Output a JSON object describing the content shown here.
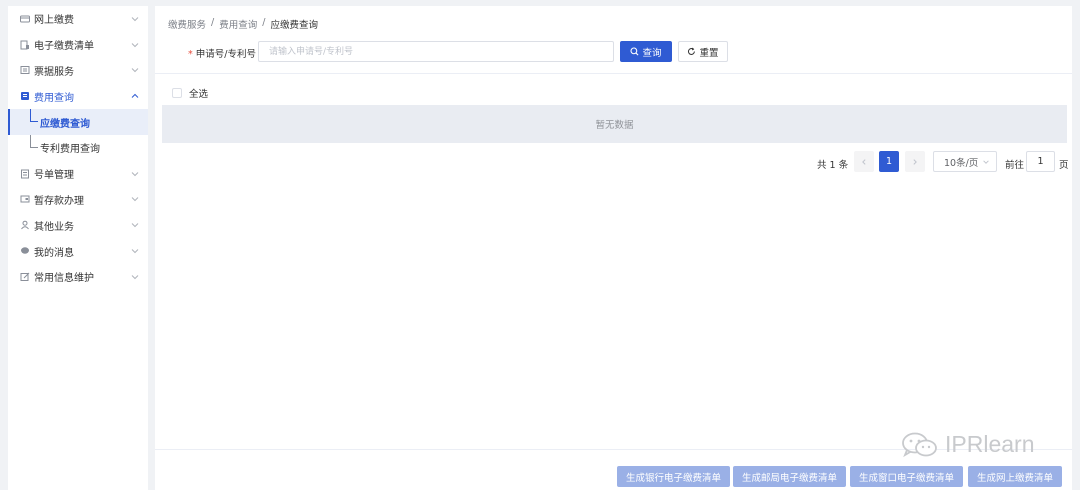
{
  "sidebar": {
    "items": [
      {
        "label": "网上缴费",
        "icon": "card-icon"
      },
      {
        "label": "电子缴费清单",
        "icon": "receipt-icon"
      },
      {
        "label": "票据服务",
        "icon": "ticket-icon"
      },
      {
        "label": "费用查询",
        "icon": "search-doc-icon",
        "open": true,
        "children": [
          {
            "label": "应缴费查询",
            "active": true
          },
          {
            "label": "专利费用查询",
            "active": false
          }
        ]
      },
      {
        "label": "号单管理",
        "icon": "list-icon"
      },
      {
        "label": "暂存款办理",
        "icon": "wallet-icon"
      },
      {
        "label": "其他业务",
        "icon": "user-icon"
      },
      {
        "label": "我的消息",
        "icon": "chat-icon"
      },
      {
        "label": "常用信息维护",
        "icon": "edit-icon"
      }
    ]
  },
  "breadcrumb": {
    "level1": "缴费服务",
    "level2": "费用查询",
    "current": "应缴费查询",
    "separator": "/"
  },
  "search": {
    "required_mark": "*",
    "label": "申请号/专利号",
    "placeholder": "请输入申请号/专利号",
    "value": "",
    "search_label": "查询",
    "reset_label": "重置"
  },
  "table": {
    "select_all_label": "全选",
    "empty_text": "暂无数据"
  },
  "pagination": {
    "total_text": "共 1 条",
    "current_page": "1",
    "page_size": "10条/页",
    "goto_label": "前往",
    "goto_value": "1",
    "goto_suffix": "页"
  },
  "footer_buttons": [
    "生成银行电子缴费清单",
    "生成邮局电子缴费清单",
    "生成窗口电子缴费清单",
    "生成网上缴费清单"
  ],
  "watermark": {
    "text": "IPRlearn"
  },
  "colors": {
    "primary": "#2f5bd3",
    "disabled_btn": "#9ab0e6",
    "empty_bg": "#e9ecf2"
  }
}
